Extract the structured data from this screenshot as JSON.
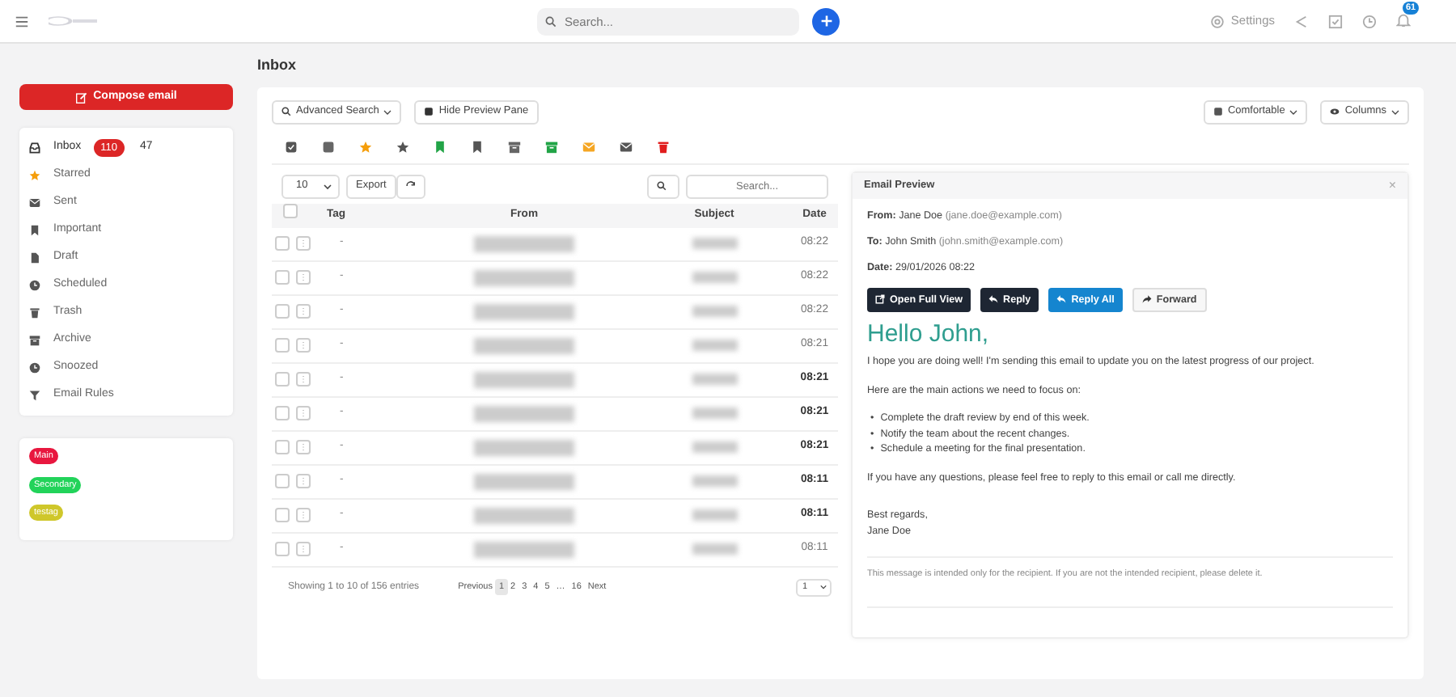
{
  "topbar": {
    "search_placeholder": "Search...",
    "settings": "Settings",
    "notification_count": "61"
  },
  "compose": "Compose email",
  "folders": [
    {
      "label": "Inbox",
      "selected": true,
      "badge": "110",
      "count": "47"
    },
    {
      "label": "Starred",
      "selected": false
    },
    {
      "label": "Sent",
      "selected": false
    },
    {
      "label": "Important",
      "selected": false
    },
    {
      "label": "Draft",
      "selected": false
    },
    {
      "label": "Scheduled",
      "selected": false
    },
    {
      "label": "Trash",
      "selected": false
    },
    {
      "label": "Archive",
      "selected": false
    },
    {
      "label": "Snoozed",
      "selected": false
    },
    {
      "label": "Email Rules",
      "selected": false
    }
  ],
  "tags": [
    {
      "label": "Main",
      "color": "#e8173f"
    },
    {
      "label": "Secondary",
      "color": "#22d35a"
    },
    {
      "label": "testag",
      "color": "#cfc72b"
    }
  ],
  "page_title": "Inbox",
  "toolbar": {
    "advanced_search": "Advanced Search",
    "hide_preview": "Hide Preview Pane",
    "density": "Comfortable",
    "columns": "Columns"
  },
  "table": {
    "page_size": "10",
    "export": "Export",
    "search_placeholder": "Search...",
    "columns": [
      "Tag",
      "From",
      "Subject",
      "Date"
    ],
    "select_all_checked": false,
    "rows": [
      {
        "tag": "-",
        "date": "08:22",
        "bold": false,
        "checked": false
      },
      {
        "tag": "-",
        "date": "08:22",
        "bold": false,
        "checked": false
      },
      {
        "tag": "-",
        "date": "08:22",
        "bold": false,
        "checked": false
      },
      {
        "tag": "-",
        "date": "08:21",
        "bold": false,
        "checked": false
      },
      {
        "tag": "-",
        "date": "08:21",
        "bold": true,
        "checked": false
      },
      {
        "tag": "-",
        "date": "08:21",
        "bold": true,
        "checked": false
      },
      {
        "tag": "-",
        "date": "08:21",
        "bold": true,
        "checked": false
      },
      {
        "tag": "-",
        "date": "08:11",
        "bold": true,
        "checked": false
      },
      {
        "tag": "-",
        "date": "08:11",
        "bold": true,
        "checked": false
      },
      {
        "tag": "-",
        "date": "08:11",
        "bold": false,
        "checked": false
      }
    ],
    "info": "Showing 1 to 10 of 156 entries",
    "pages": [
      {
        "label": "Previous",
        "selected": false
      },
      {
        "label": "1",
        "selected": true
      },
      {
        "label": "2",
        "selected": false
      },
      {
        "label": "3",
        "selected": false
      },
      {
        "label": "4",
        "selected": false
      },
      {
        "label": "5",
        "selected": false
      },
      {
        "label": "…",
        "selected": false
      },
      {
        "label": "16",
        "selected": false
      },
      {
        "label": "Next",
        "selected": false
      }
    ],
    "page_select": "1"
  },
  "preview": {
    "title": "Email Preview",
    "close": "×",
    "meta": [
      {
        "label": "From:",
        "name": "Jane Doe",
        "email": "(jane.doe@example.com)"
      },
      {
        "label": "To:",
        "name": "John Smith",
        "email": "(john.smith@example.com)"
      },
      {
        "label": "Date:",
        "name": "29/01/2026 08:22"
      }
    ],
    "buttons": [
      {
        "label": "Open Full View",
        "kind": "dark"
      },
      {
        "label": "Reply",
        "kind": "dark"
      },
      {
        "label": "Reply All",
        "kind": "primary"
      },
      {
        "label": "Forward",
        "kind": "light"
      }
    ],
    "greeting": "Hello John,",
    "intro": "I hope you are doing well! I'm sending this email to update you on the latest progress of our project.",
    "lead_in": "Here are the main actions we need to focus on:",
    "bullets": [
      {
        "marker": "•",
        "text": "Complete the draft review by end of this week."
      },
      {
        "marker": "•",
        "text": "Notify the team about the recent changes."
      },
      {
        "marker": "•",
        "text": "Schedule a meeting for the final presentation."
      }
    ],
    "closing": "If you have any questions, please feel free to reply to this email or call me directly.",
    "signoff": [
      "Best regards,",
      "Jane Doe"
    ],
    "disclaimer": "This message is intended only for the recipient. If you are not the intended recipient, please delete it."
  }
}
